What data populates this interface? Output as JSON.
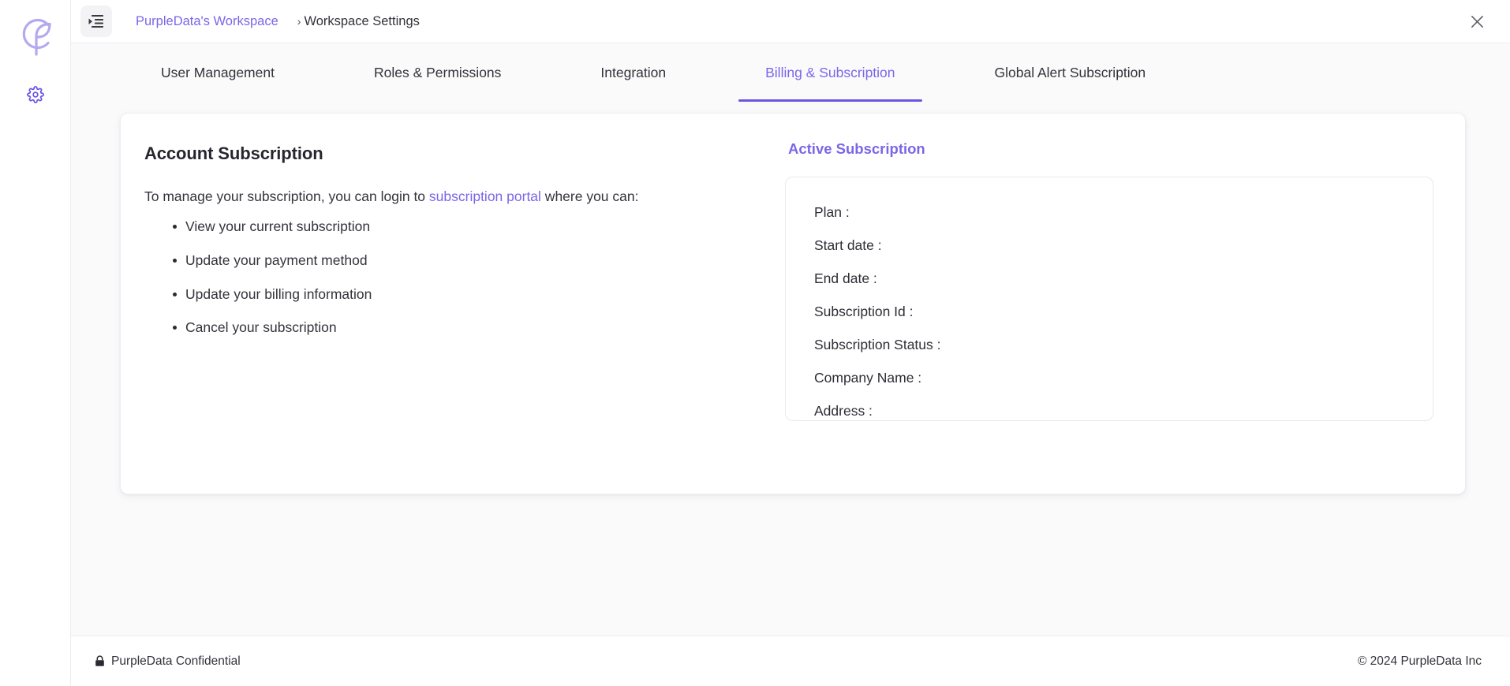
{
  "brand": {
    "logo_icon": "purpledata-leaf-logo",
    "accent": "#7b66e8",
    "accent_strong": "#6c55e0",
    "logo_purple": "#b4a9ef"
  },
  "rail": {
    "settings_icon": "gear-icon"
  },
  "topbar": {
    "menu_icon": "sidebar-toggle-icon",
    "breadcrumb": {
      "workspace": "PurpleData's Workspace",
      "separator": "›",
      "current": "Workspace Settings"
    },
    "close_icon": "close-icon"
  },
  "tabs": [
    {
      "label": "User Management",
      "active": false
    },
    {
      "label": "Roles & Permissions",
      "active": false
    },
    {
      "label": "Integration",
      "active": false
    },
    {
      "label": "Billing & Subscription",
      "active": true
    },
    {
      "label": "Global Alert Subscription",
      "active": false
    }
  ],
  "account_subscription": {
    "title": "Account Subscription",
    "intro_before": "To manage your subscription, you can login to ",
    "portal_link": "subscription portal",
    "intro_after": " where you can:",
    "bullets": [
      "View your current subscription",
      "Update your payment method",
      "Update your billing information",
      "Cancel your subscription"
    ]
  },
  "active_subscription": {
    "title": "Active Subscription",
    "rows": [
      {
        "label": "Plan :",
        "value": ""
      },
      {
        "label": "Start date :",
        "value": ""
      },
      {
        "label": "End date :",
        "value": ""
      },
      {
        "label": "Subscription Id :",
        "value": ""
      },
      {
        "label": "Subscription Status :",
        "value": ""
      },
      {
        "label": "Company Name :",
        "value": ""
      },
      {
        "label": "Address :",
        "value": ""
      }
    ]
  },
  "footer": {
    "lock_icon": "lock-icon",
    "confidential": "PurpleData Confidential",
    "copyright": "© 2024 PurpleData Inc"
  }
}
